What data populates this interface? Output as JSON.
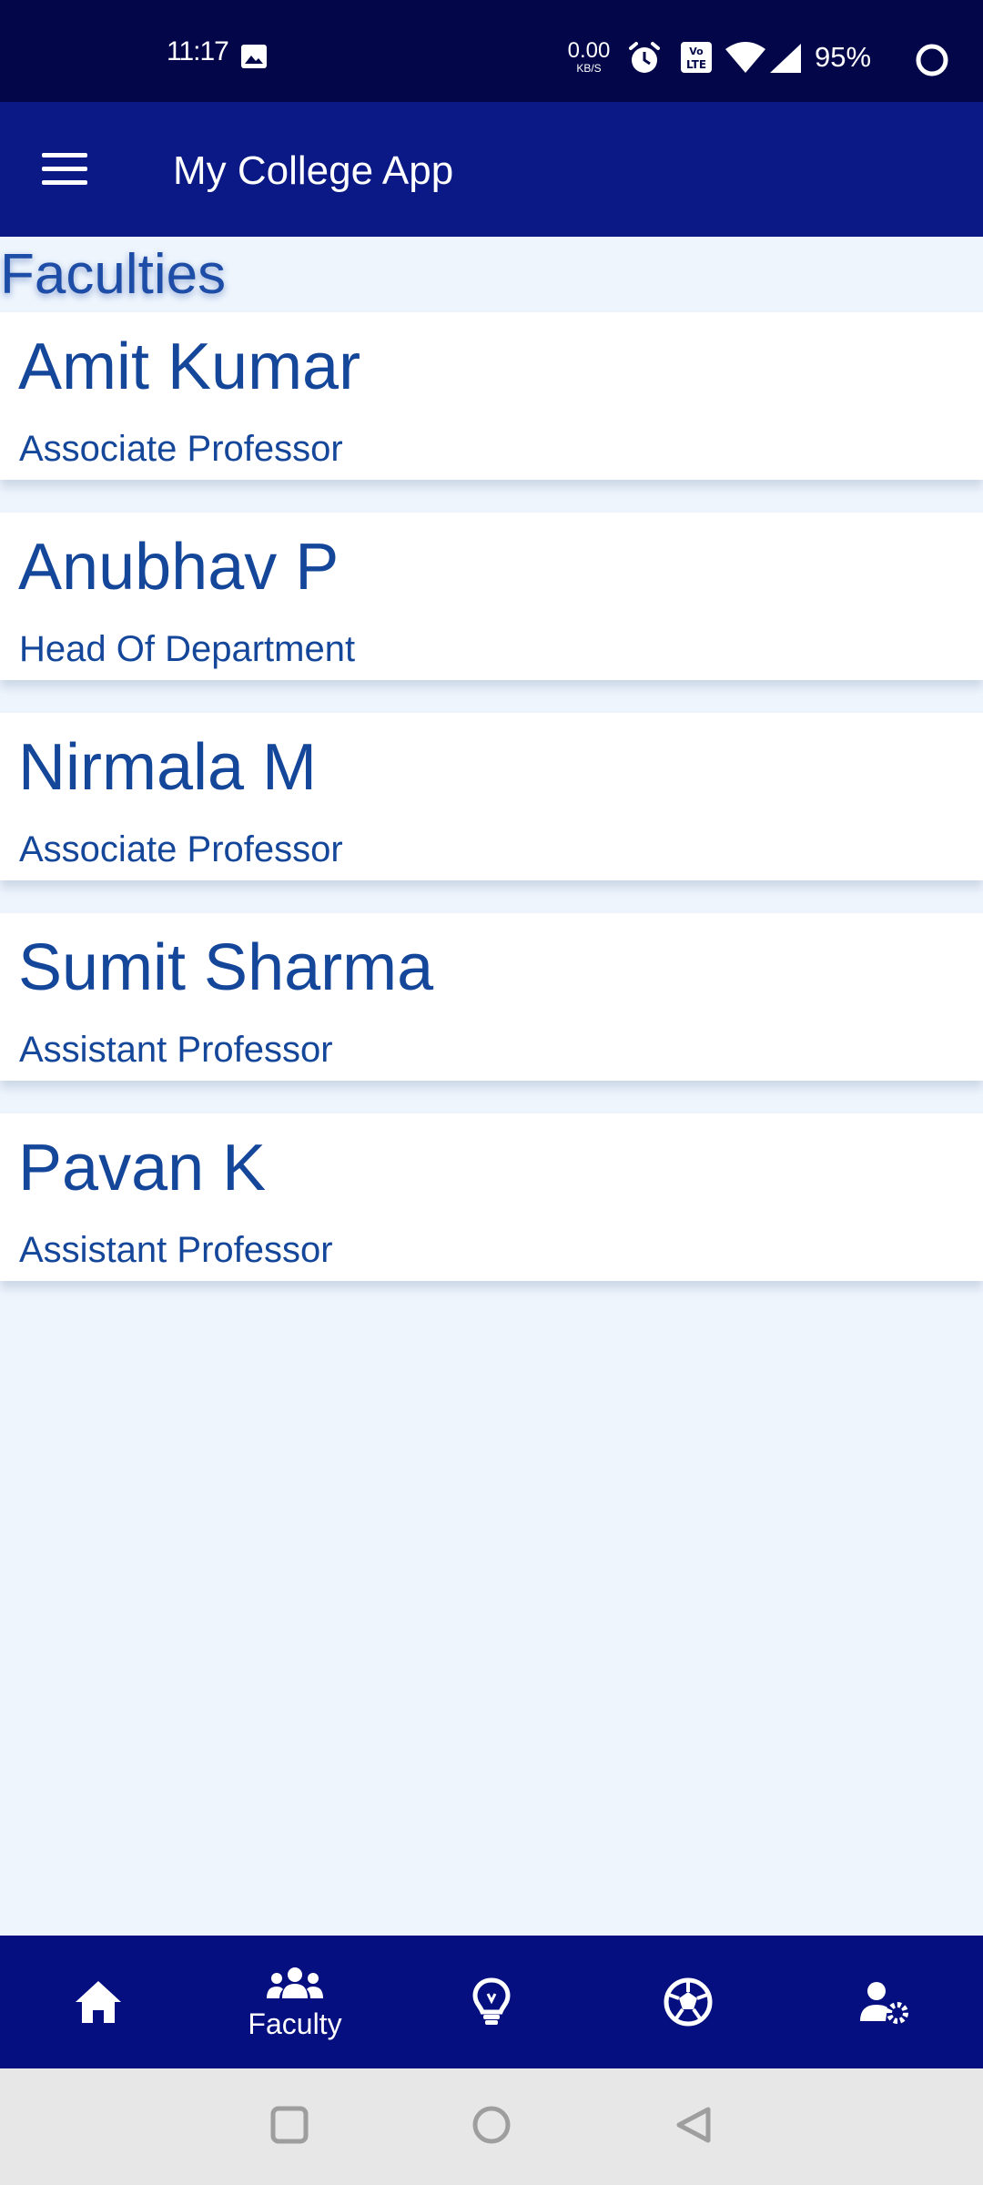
{
  "status_bar": {
    "time": "11:17",
    "net_speed_value": "0.00",
    "net_speed_unit": "KB/S",
    "battery": "95%",
    "icons": [
      "image-icon",
      "alarm-icon",
      "volte-icon",
      "wifi-icon",
      "signal-icon",
      "battery-ring-icon"
    ]
  },
  "app_bar": {
    "title": "My College App",
    "menu_icon": "hamburger-menu-icon"
  },
  "section_title": "Faculties",
  "faculty": [
    {
      "name": "Amit Kumar",
      "role": "Associate Professor"
    },
    {
      "name": "Anubhav P",
      "role": "Head Of Department"
    },
    {
      "name": "Nirmala M",
      "role": "Associate Professor"
    },
    {
      "name": "Sumit Sharma",
      "role": "Assistant Professor"
    },
    {
      "name": "Pavan K",
      "role": "Assistant Professor"
    }
  ],
  "bottom_nav": {
    "items": [
      {
        "icon": "home-icon",
        "label": ""
      },
      {
        "icon": "faculty-group-icon",
        "label": "Faculty",
        "selected": true
      },
      {
        "icon": "lightbulb-icon",
        "label": ""
      },
      {
        "icon": "football-icon",
        "label": ""
      },
      {
        "icon": "user-settings-icon",
        "label": ""
      }
    ]
  },
  "system_nav": {
    "icons": [
      "recents-square-icon",
      "home-circle-icon",
      "back-triangle-icon"
    ]
  },
  "colors": {
    "status_bar_bg": "#03074a",
    "app_bar_bg": "#0a1985",
    "bottom_nav_bg": "#050f80",
    "page_bg": "#eef5fd",
    "accent_text": "#14469a"
  }
}
